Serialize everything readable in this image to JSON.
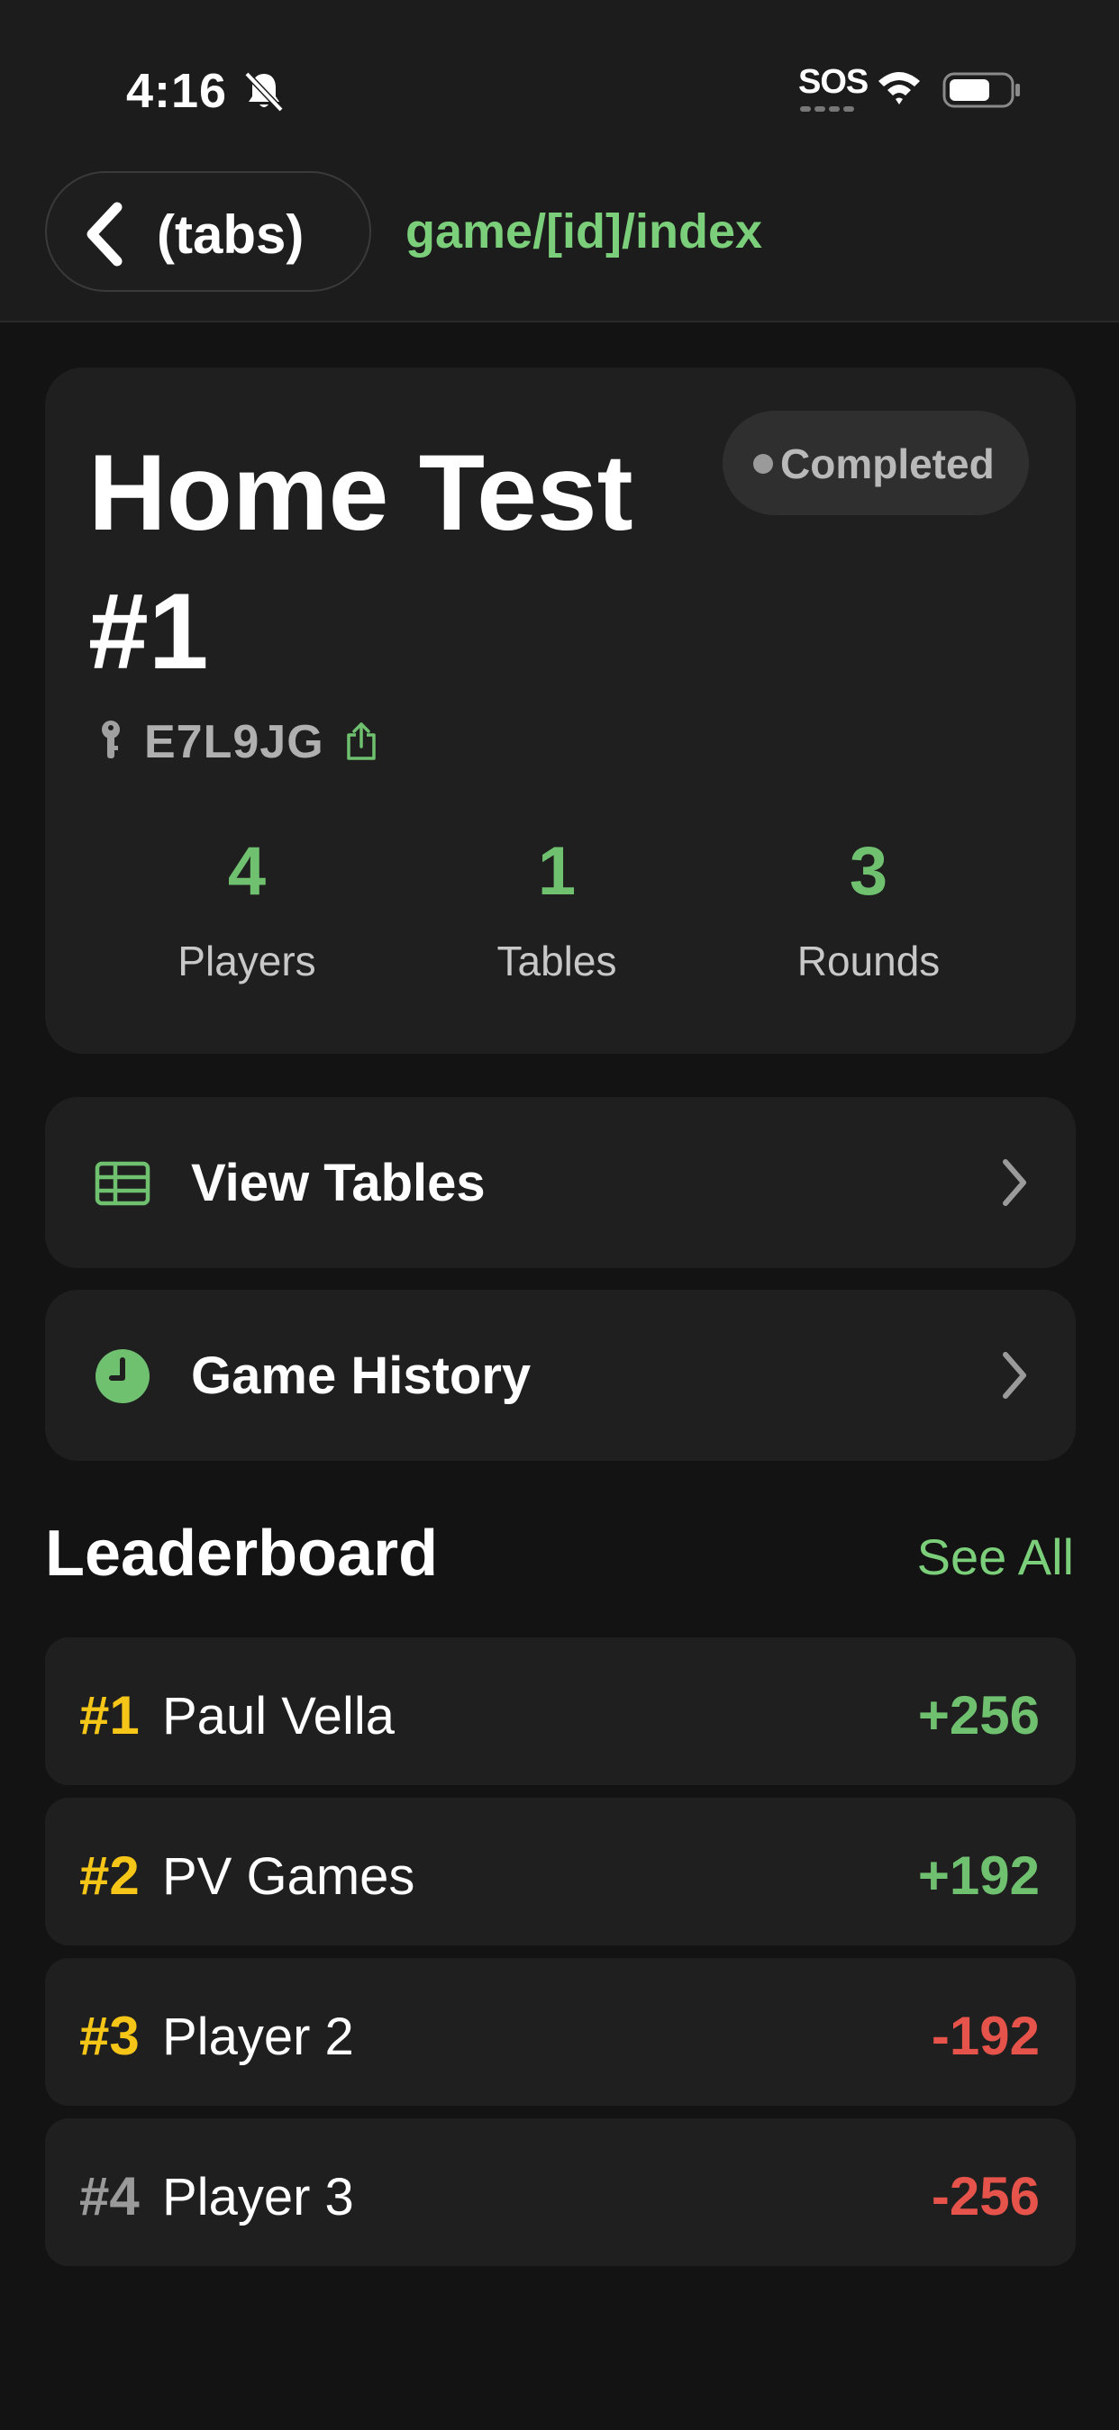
{
  "status_bar": {
    "time": "4:16",
    "carrier": "SOS",
    "icons": [
      "bell-slash-icon",
      "wifi-icon",
      "battery-icon"
    ]
  },
  "header": {
    "back_label": "(tabs)",
    "route": "game/[id]/index"
  },
  "game": {
    "title": "Home Test #1",
    "status": "Completed",
    "code": "E7L9JG",
    "stats": [
      {
        "value": "4",
        "label": "Players"
      },
      {
        "value": "1",
        "label": "Tables"
      },
      {
        "value": "3",
        "label": "Rounds"
      }
    ]
  },
  "menu": [
    {
      "label": "View Tables",
      "icon": "table-icon"
    },
    {
      "label": "Game History",
      "icon": "clock-icon"
    }
  ],
  "leaderboard": {
    "title": "Leaderboard",
    "see_all": "See All",
    "rows": [
      {
        "rank": "#1",
        "name": "Paul Vella",
        "score": "+256"
      },
      {
        "rank": "#2",
        "name": "PV Games",
        "score": "+192"
      },
      {
        "rank": "#3",
        "name": "Player 2",
        "score": "-192"
      },
      {
        "rank": "#4",
        "name": "Player 3",
        "score": "-256"
      }
    ]
  },
  "colors": {
    "accent_green": "#6fc170",
    "negative_red": "#e5534b",
    "rank_gold": "#f5c518",
    "rank_gray": "#9a9a9a",
    "card": "#1f1f1f",
    "background": "#131313"
  }
}
